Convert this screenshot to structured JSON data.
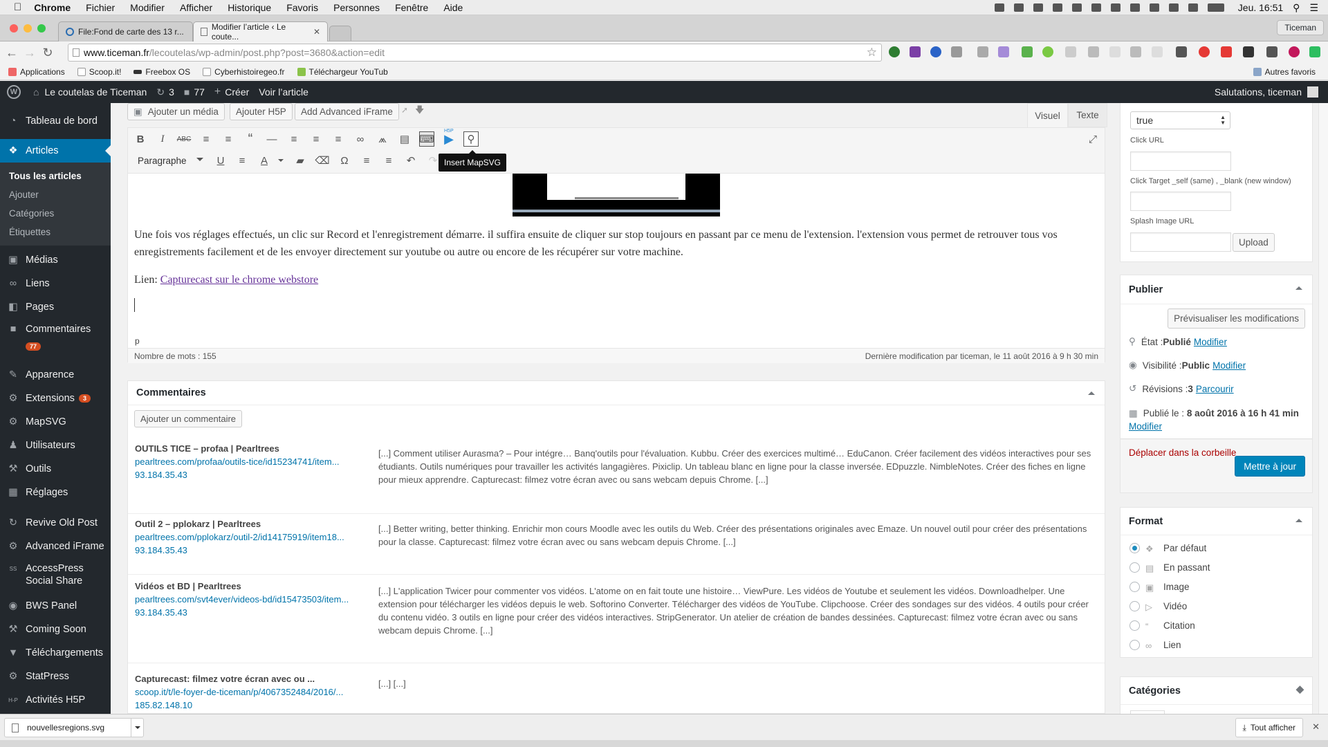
{
  "macmenu": {
    "app": "Chrome",
    "items": [
      "Fichier",
      "Modifier",
      "Afficher",
      "Historique",
      "Favoris",
      "Personnes",
      "Fenêtre",
      "Aide"
    ],
    "clock": "Jeu. 16:51"
  },
  "browser": {
    "tabs": [
      {
        "title": "File:Fond de carte des 13 r..."
      },
      {
        "title": "Modifier l’article ‹ Le coute..."
      }
    ],
    "profile": "Ticeman",
    "url_host": "www.ticeman.fr",
    "url_path": "/lecoutelas/wp-admin/post.php?post=3680&action=edit",
    "bookmarks": [
      "Applications",
      "Scoop.it!",
      "Freebox OS",
      "Cyberhistoiregeo.fr",
      "Téléchargeur YouTub"
    ],
    "other_bookmarks": "Autres favoris"
  },
  "adminbar": {
    "site": "Le coutelas de Ticeman",
    "updates": "3",
    "comments": "77",
    "new": "Créer",
    "view": "Voir l’article",
    "greeting": "Salutations, ticeman"
  },
  "sidebar": {
    "items": [
      {
        "label": "Tableau de bord"
      },
      {
        "label": "Articles"
      },
      {
        "label": "Médias"
      },
      {
        "label": "Liens"
      },
      {
        "label": "Pages"
      },
      {
        "label": "Commentaires",
        "badge": "77"
      },
      {
        "label": "Apparence"
      },
      {
        "label": "Extensions",
        "badge": "3"
      },
      {
        "label": "MapSVG"
      },
      {
        "label": "Utilisateurs"
      },
      {
        "label": "Outils"
      },
      {
        "label": "Réglages"
      },
      {
        "label": "Revive Old Post"
      },
      {
        "label": "Advanced iFrame"
      },
      {
        "label": "AccessPress Social Share"
      },
      {
        "label": "BWS Panel"
      },
      {
        "label": "Coming Soon"
      },
      {
        "label": "Téléchargements"
      },
      {
        "label": "StatPress"
      },
      {
        "label": "Activités H5P"
      }
    ],
    "articles_sub": [
      "Tous les articles",
      "Ajouter",
      "Catégories",
      "Étiquettes"
    ]
  },
  "editor": {
    "add_media": "Ajouter un média",
    "add_h5p": "Ajouter H5P",
    "add_iframe": "Add Advanced iFrame",
    "tab_visual": "Visuel",
    "tab_text": "Texte",
    "format_select": "Paragraphe",
    "tooltip": "Insert MapSVG",
    "h5p_label": "H5P",
    "paragraph1": "Une fois vos réglages effectués, un clic sur Record et l'enregistrement démarre. il suffira ensuite de cliquer sur stop toujours en passant par ce menu de l'extension. l'extension vous permet de retrouver tous vos enregistrements facilement et de les envoyer directement sur youtube ou autre ou encore de les récupérer sur votre machine.",
    "link_prefix": "Lien: ",
    "link_text": "Capturecast sur le chrome webstore",
    "path": "p",
    "word_count": "Nombre de mots : 155",
    "last_modified": "Dernière modification par ticeman, le 11 août 2016 à 9 h 30 min"
  },
  "comments_box": {
    "title": "Commentaires",
    "add_button": "Ajouter un commentaire",
    "rows": [
      {
        "author": "OUTILS TICE – profaa | Pearltrees",
        "url": "pearltrees.com/profaa/outils-tice/id15234741/item...",
        "ip": "93.184.35.43",
        "text": "[...] Comment utiliser Aurasma? – Pour intégre… Banq'outils pour l'évaluation. Kubbu. Créer des exercices multimé… EduCanon. Créer facilement des vidéos interactives pour ses étudiants. Outils numériques pour travailler les activités langagières. Pixiclip. Un tableau blanc en ligne pour la classe inversée. EDpuzzle. NimbleNotes. Créer des fiches en ligne pour mieux apprendre. Capturecast: filmez votre écran avec ou sans webcam depuis Chrome. [...]"
      },
      {
        "author": "Outil 2 – pplokarz | Pearltrees",
        "url": "pearltrees.com/pplokarz/outil-2/id14175919/item18...",
        "ip": "93.184.35.43",
        "text": "[...] Better writing, better thinking. Enrichir mon cours Moodle avec les outils du Web. Créer des présentations originales avec Emaze. Un nouvel outil pour créer des présentations pour la classe. Capturecast: filmez votre écran avec ou sans webcam depuis Chrome. [...]"
      },
      {
        "author": "Vidéos et BD | Pearltrees",
        "url": "pearltrees.com/svt4ever/videos-bd/id15473503/item...",
        "ip": "93.184.35.43",
        "text": "[...] L'application Twicer pour commenter vos vidéos. L'atome on en fait toute une histoire… ViewPure. Les vidéos de Youtube et seulement les vidéos. Downloadhelper. Une extension pour télécharger les vidéos depuis le web. Softorino Converter. Télécharger des vidéos de YouTube. Clipchoose. Créer des sondages sur des vidéos. 4 outils pour créer du contenu vidéo. 3 outils en ligne pour créer des vidéos interactives. StripGenerator. Un atelier de création de bandes dessinées. Capturecast: filmez votre écran avec ou sans webcam depuis Chrome. [...]"
      },
      {
        "author": "Capturecast: filmez votre écran avec ou ...",
        "url": "scoop.it/t/le-foyer-de-ticeman/p/4067352484/2016/...",
        "ip": "185.82.148.10",
        "text": "[...]  [...]"
      }
    ]
  },
  "iframe_settings": {
    "select_value": "true",
    "click_url_label": "Click URL",
    "click_target_label": "Click Target _self (same) , _blank (new window)",
    "splash_label": "Splash Image URL",
    "upload": "Upload"
  },
  "publish": {
    "title": "Publier",
    "preview": "Prévisualiser les modifications",
    "status_label": "État : ",
    "status_value": "Publié",
    "visibility_label": "Visibilité : ",
    "visibility_value": "Public",
    "revisions_label": "Révisions : ",
    "revisions_value": "3",
    "published_label": "Publié le : ",
    "published_value": "8 août 2016 à 16 h 41 min",
    "modify": "Modifier",
    "browse": "Parcourir",
    "trash": "Déplacer dans la corbeille",
    "update": "Mettre à jour"
  },
  "format": {
    "title": "Format",
    "options": [
      "Par défaut",
      "En passant",
      "Image",
      "Vidéo",
      "Citation",
      "Lien"
    ],
    "selected": "Par défaut"
  },
  "categories": {
    "title": "Catégories"
  },
  "download": {
    "file": "nouvellesregions.svg",
    "show_all": "Tout afficher"
  },
  "colors": {
    "wp_blue": "#0073aa",
    "admin_dark": "#23282d",
    "badge": "#d54e21",
    "trash": "#a00"
  }
}
